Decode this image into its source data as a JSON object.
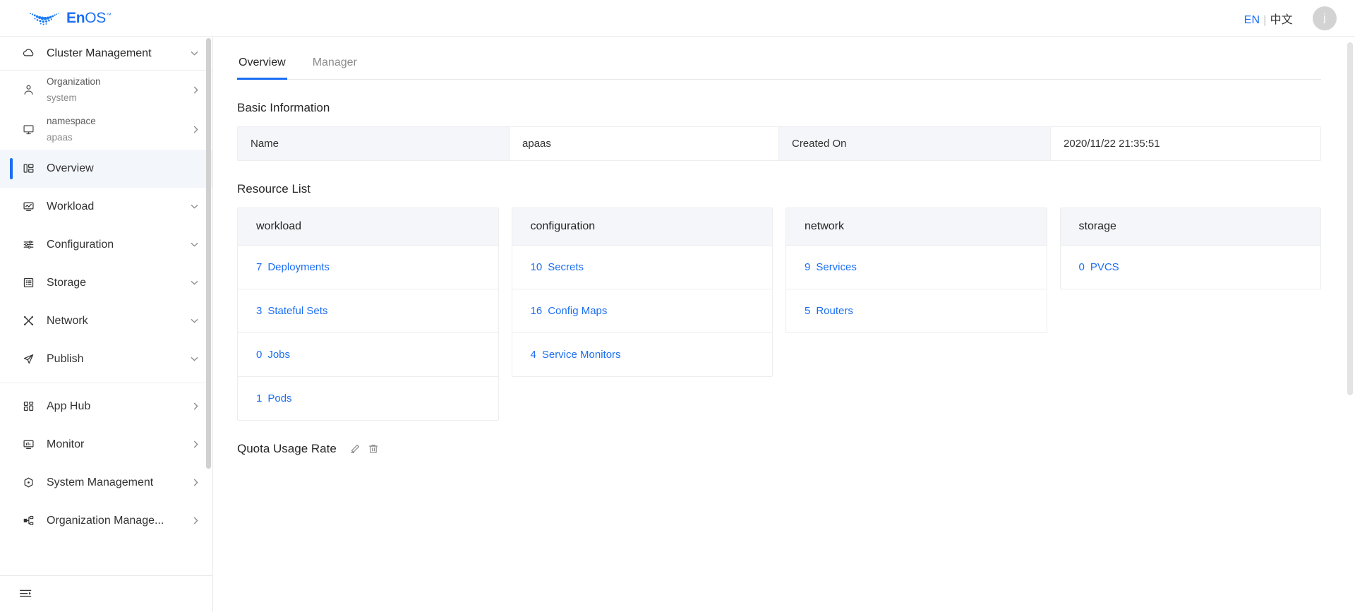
{
  "header": {
    "logo_text_bold": "En",
    "logo_text_light": "OS",
    "logo_tm": "™",
    "lang_en": "EN",
    "lang_sep": "|",
    "lang_zh": "中文",
    "avatar_initial": "j",
    "accent_color": "#1b6ef3"
  },
  "sidebar": {
    "cluster": {
      "label": "Cluster Management",
      "icon": "cloud-icon"
    },
    "context": [
      {
        "line1": "Organization",
        "line2": "system",
        "icon": "user-icon"
      },
      {
        "line1": "namespace",
        "line2": "apaas",
        "icon": "monitor-icon"
      }
    ],
    "nav": [
      {
        "label": "Overview",
        "icon": "dashboard-icon",
        "active": true,
        "chevron": ""
      },
      {
        "label": "Workload",
        "icon": "workload-icon",
        "active": false,
        "chevron": "down"
      },
      {
        "label": "Configuration",
        "icon": "sliders-icon",
        "active": false,
        "chevron": "down"
      },
      {
        "label": "Storage",
        "icon": "storage-icon",
        "active": false,
        "chevron": "down"
      },
      {
        "label": "Network",
        "icon": "network-icon",
        "active": false,
        "chevron": "down"
      },
      {
        "label": "Publish",
        "icon": "send-icon",
        "active": false,
        "chevron": "down"
      }
    ],
    "nav2": [
      {
        "label": "App Hub",
        "icon": "apps-icon",
        "active": false,
        "chevron": "right"
      },
      {
        "label": "Monitor",
        "icon": "monitor-chart-icon",
        "active": false,
        "chevron": "right"
      },
      {
        "label": "System Management",
        "icon": "system-icon",
        "active": false,
        "chevron": "right"
      },
      {
        "label": "Organization Manage...",
        "icon": "org-icon",
        "active": false,
        "chevron": "right"
      }
    ],
    "collapse_icon": "collapse-sidebar-icon"
  },
  "main": {
    "tabs": [
      {
        "label": "Overview",
        "active": true
      },
      {
        "label": "Manager",
        "active": false
      }
    ],
    "basic_information": {
      "title": "Basic Information",
      "cells": [
        {
          "text": "Name",
          "type": "key"
        },
        {
          "text": "apaas",
          "type": "value"
        },
        {
          "text": "Created On",
          "type": "key"
        },
        {
          "text": "2020/11/22 21:35:51",
          "type": "value"
        }
      ]
    },
    "resource_list": {
      "title": "Resource List",
      "cards": [
        {
          "title": "workload",
          "rows": [
            {
              "count": "7",
              "label": "Deployments"
            },
            {
              "count": "3",
              "label": "Stateful Sets"
            },
            {
              "count": "0",
              "label": "Jobs"
            },
            {
              "count": "1",
              "label": "Pods"
            }
          ]
        },
        {
          "title": "configuration",
          "rows": [
            {
              "count": "10",
              "label": "Secrets"
            },
            {
              "count": "16",
              "label": "Config Maps"
            },
            {
              "count": "4",
              "label": "Service Monitors"
            }
          ]
        },
        {
          "title": "network",
          "rows": [
            {
              "count": "9",
              "label": "Services"
            },
            {
              "count": "5",
              "label": "Routers"
            }
          ]
        },
        {
          "title": "storage",
          "rows": [
            {
              "count": "0",
              "label": "PVCS"
            }
          ]
        }
      ]
    },
    "quota": {
      "title": "Quota Usage Rate",
      "edit_icon": "edit-pencil-icon",
      "delete_icon": "trash-icon"
    }
  }
}
